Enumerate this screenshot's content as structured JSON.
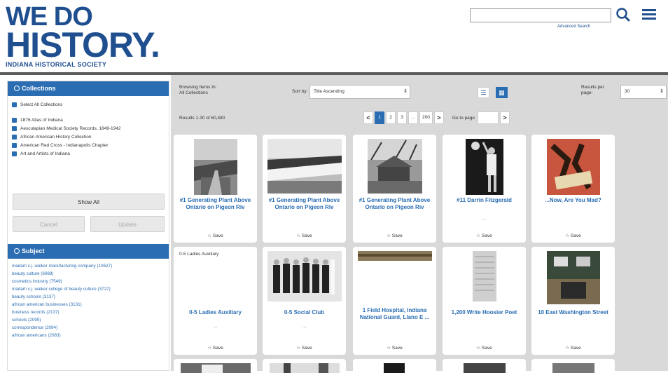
{
  "logo": {
    "line1": "WE DO",
    "line2": "HISTORY.",
    "line3": "INDIANA HISTORICAL SOCIETY"
  },
  "search": {
    "placeholder": "",
    "advanced_label": "Advanced Search"
  },
  "collections": {
    "header": "Collections",
    "select_all": "Select All Collections",
    "items": [
      "1876 Atlas of Indiana",
      "Aesculapian Medical Society Records, 1849-1942",
      "African American History Collection",
      "American Red Cross - Indianapolis Chapter",
      "Art and Artists of Indiana"
    ],
    "show_all": "Show All",
    "cancel": "Cancel",
    "update": "Update"
  },
  "subject": {
    "header": "Subject",
    "items": [
      "madam c.j. walker manufacturing company (10627)",
      "beauty culture (6088)",
      "cosmetics industry (7549)",
      "madam c.j. walker college of beauty culture (3727)",
      "beauty schools (3137)",
      "african american businesses (3131)",
      "business records (2137)",
      "schools (2095)",
      "correspondence (2094)",
      "african americans (2083)"
    ]
  },
  "toolbar": {
    "browsing_line1": "Browsing Items In:",
    "browsing_line2": "All Collections",
    "sort_label": "Sort by:",
    "sort_value": "Title Ascending",
    "rpp_line1": "Results per",
    "rpp_line2": "page:",
    "rpp_value": "30"
  },
  "results_text": "Results 1-30 of 60,480",
  "pager": {
    "prev": "<",
    "pages": [
      "1",
      "2",
      "3",
      "...",
      "200"
    ],
    "next": ">",
    "goto_label": "Go to page",
    "go": ">"
  },
  "cards": [
    {
      "title": "#1 Generating Plant Above Ontario on Pigeon Riv",
      "save": "☆ Save",
      "dots": ""
    },
    {
      "title": "#1 Generating Plant Above Ontario on Pigeon Riv",
      "save": "☆ Save",
      "dots": ""
    },
    {
      "title": "#1 Generating Plant Above Ontario on Pigeon Riv",
      "save": "☆ Save",
      "dots": ""
    },
    {
      "title": "#11 Darrin Fitzgerald",
      "save": "☆ Save",
      "dots": "..."
    },
    {
      "title": "...Now, Are You Mad?",
      "save": "☆ Save",
      "dots": ""
    },
    {
      "title": "0-5 Ladies Auxiliary",
      "small": "0-5 Ladies Auxiliary",
      "save": "☆ Save",
      "dots": "..."
    },
    {
      "title": "0-5 Social Club",
      "save": "☆ Save",
      "dots": "..."
    },
    {
      "title": "1 Field Hospital, Indiana National Guard, Llano E ...",
      "save": "☆ Save",
      "dots": ""
    },
    {
      "title": "1,200 Write Hoosier Poet",
      "save": "☆ Save",
      "dots": ""
    },
    {
      "title": "10 East Washington Street",
      "save": "☆ Save",
      "dots": ""
    }
  ]
}
